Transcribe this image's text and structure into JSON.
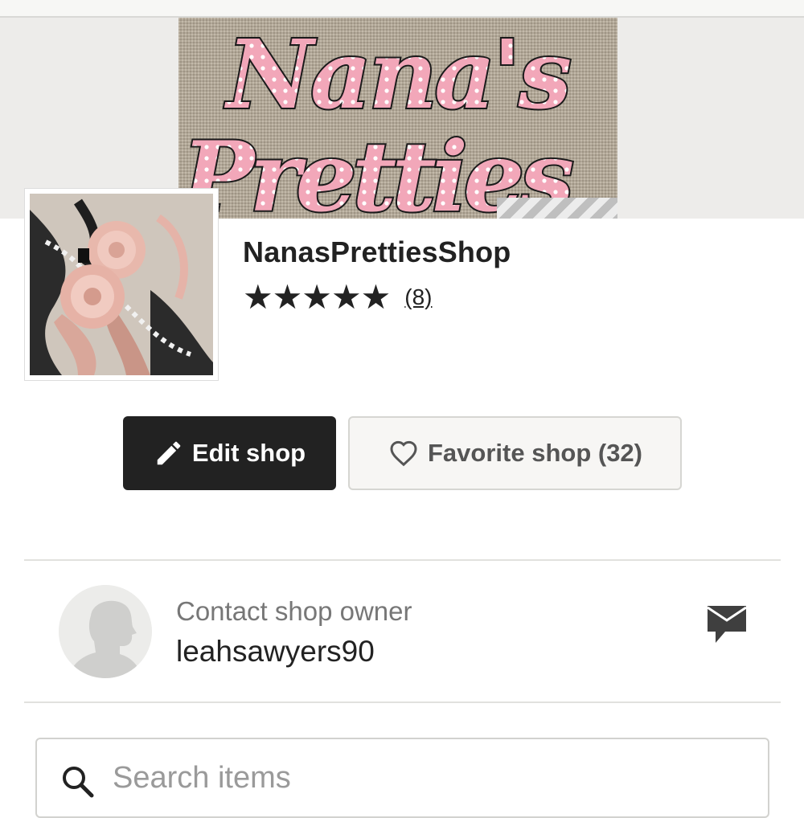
{
  "banner": {
    "logo_text": "Nana's Pretties",
    "colors": {
      "pink": "#f2a7b9",
      "outline": "#1a1a1a",
      "burlap": "#b7ab99"
    }
  },
  "shop": {
    "name": "NanasPrettiesShop",
    "rating": 5,
    "stars": "★★★★★",
    "review_count": "(8)"
  },
  "actions": {
    "edit_label": "Edit shop",
    "edit_icon": "pencil-icon",
    "favorite_label": "Favorite shop (32)",
    "favorite_icon": "heart-outline-icon"
  },
  "owner": {
    "label": "Contact shop owner",
    "username": "leahsawyers90",
    "message_icon": "message-icon"
  },
  "search": {
    "placeholder": "Search items",
    "icon": "search-icon"
  }
}
